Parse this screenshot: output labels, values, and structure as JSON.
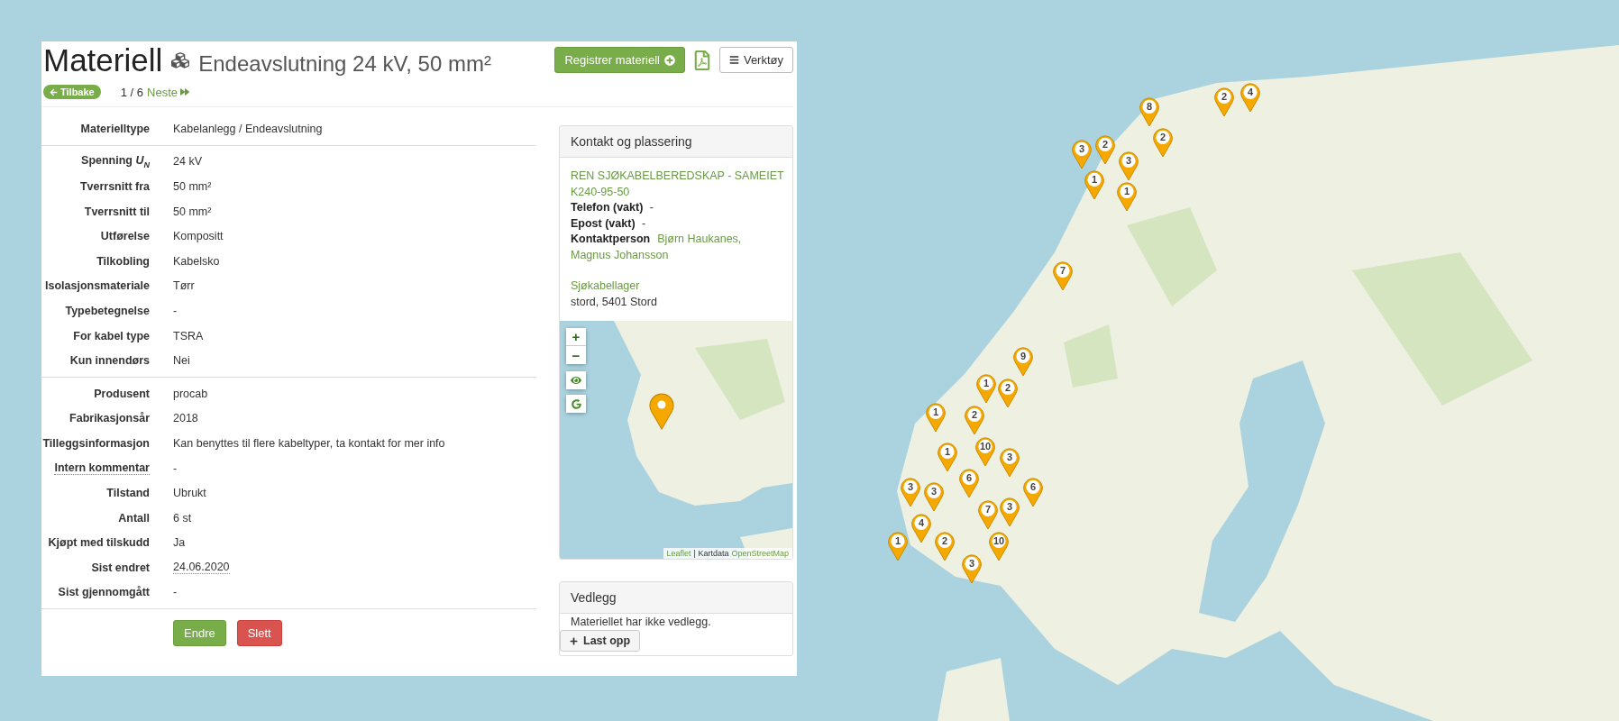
{
  "header": {
    "title": "Materiell",
    "subtitle": "Endeavslutning 24 kV, 50 mm²",
    "register_button": "Registrer materiell",
    "tools_button": "Verktøy",
    "back_button": "Tilbake",
    "pager": "1 / 6",
    "next_link": "Neste"
  },
  "detail_groups": [
    {
      "rows": [
        {
          "label": "Materielltype",
          "value": "Kabelanlegg / Endeavslutning",
          "label_tooltip": false,
          "value_tooltip": false
        }
      ]
    },
    {
      "rows": [
        {
          "label": "Spenning *U*$_{N}$",
          "value": "24 kV",
          "label_tooltip": false,
          "value_tooltip": false
        },
        {
          "label": "Tverrsnitt fra",
          "value": "50 mm²",
          "label_tooltip": false,
          "value_tooltip": false
        },
        {
          "label": "Tverrsnitt til",
          "value": "50 mm²",
          "label_tooltip": false,
          "value_tooltip": false
        },
        {
          "label": "Utførelse",
          "value": "Kompositt",
          "label_tooltip": false,
          "value_tooltip": false
        },
        {
          "label": "Tilkobling",
          "value": "Kabelsko",
          "label_tooltip": false,
          "value_tooltip": false
        },
        {
          "label": "Isolasjonsmateriale",
          "value": "Tørr",
          "label_tooltip": false,
          "value_tooltip": false
        },
        {
          "label": "Typebetegnelse",
          "value": "-",
          "label_tooltip": false,
          "value_tooltip": false
        },
        {
          "label": "For kabel type",
          "value": "TSRA",
          "label_tooltip": false,
          "value_tooltip": false
        },
        {
          "label": "Kun innendørs",
          "value": "Nei",
          "label_tooltip": false,
          "value_tooltip": false
        }
      ]
    },
    {
      "rows": [
        {
          "label": "Produsent",
          "value": "procab",
          "label_tooltip": false,
          "value_tooltip": false
        },
        {
          "label": "Fabrikasjonsår",
          "value": "2018",
          "label_tooltip": false,
          "value_tooltip": false
        },
        {
          "label": "Tilleggsinformasjon",
          "value": "Kan benyttes til flere kabeltyper, ta kontakt for mer info",
          "label_tooltip": false,
          "value_tooltip": false
        },
        {
          "label": "Intern kommentar",
          "value": "-",
          "label_tooltip": true,
          "value_tooltip": false
        },
        {
          "label": "Tilstand",
          "value": "Ubrukt",
          "label_tooltip": false,
          "value_tooltip": false
        },
        {
          "label": "Antall",
          "value": "6 st",
          "label_tooltip": false,
          "value_tooltip": false
        },
        {
          "label": "Kjøpt med tilskudd",
          "value": "Ja",
          "label_tooltip": false,
          "value_tooltip": false
        },
        {
          "label": "Sist endret",
          "value": "24.06.2020",
          "label_tooltip": false,
          "value_tooltip": true
        },
        {
          "label": "Sist gjennomgått",
          "value": "-",
          "label_tooltip": false,
          "value_tooltip": false
        }
      ]
    }
  ],
  "actions": [
    {
      "label": "Endre",
      "kind": "primary"
    },
    {
      "label": "Slett",
      "kind": "danger"
    }
  ],
  "contact_card": {
    "title": "Kontakt og plassering",
    "organization": "REN SJØKABELBEREDSKAP - SAMEIET",
    "code": "K240-95-50",
    "fields": [
      "**Telefon (vakt)** -",
      "**Epost (vakt)** -"
    ],
    "contact_label": "Kontaktperson",
    "contacts": [
      "Bjørn Haukanes,",
      "Magnus Johansson"
    ],
    "location_link": "Sjøkabellager",
    "address": "stord, 5401 Stord",
    "map": {
      "zoom_in": "+",
      "zoom_out": "−",
      "attribution_leaflet": "Leaflet",
      "attribution_text": "| Kartdata",
      "attribution_osm": "OpenStreetMap"
    }
  },
  "attachments_card": {
    "title": "Vedlegg",
    "empty_text": "Materiellet har ikke vedlegg.",
    "upload_button": "Last opp"
  },
  "map_markers": [
    {
      "count": "2"
    },
    {
      "count": "4"
    },
    {
      "count": "8"
    },
    {
      "count": "2"
    },
    {
      "count": "3"
    },
    {
      "count": "2"
    },
    {
      "count": "3"
    },
    {
      "count": "1"
    },
    {
      "count": "1"
    },
    {
      "count": "7"
    },
    {
      "count": "9"
    },
    {
      "count": "2"
    },
    {
      "count": "1"
    },
    {
      "count": "2"
    },
    {
      "count": "1"
    },
    {
      "count": "10"
    },
    {
      "count": "1"
    },
    {
      "count": "6"
    },
    {
      "count": "3"
    },
    {
      "count": "3"
    },
    {
      "count": "3"
    },
    {
      "count": "4"
    },
    {
      "count": "1"
    },
    {
      "count": "2"
    },
    {
      "count": "6"
    },
    {
      "count": "3"
    },
    {
      "count": "7"
    },
    {
      "count": "10"
    },
    {
      "count": "3"
    }
  ]
}
